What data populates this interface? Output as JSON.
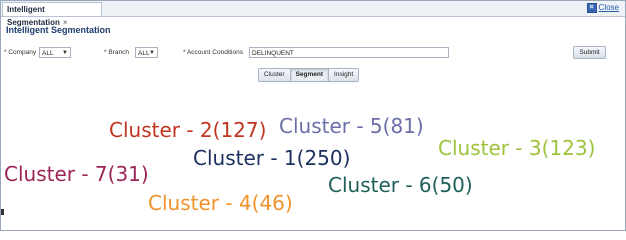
{
  "tab": {
    "label": "Intelligent Segmentation",
    "close_glyph": "×"
  },
  "close_link": {
    "label": "Close",
    "icon": "close-icon"
  },
  "page_title": "Intelligent Segmentation",
  "filters": {
    "company": {
      "label": "* Company",
      "value": "ALL"
    },
    "branch": {
      "label": "* Branch",
      "value": "ALL"
    },
    "account_conditions": {
      "label": "* Account Conditions",
      "value": "DELINQUENT"
    },
    "submit_label": "Submit"
  },
  "view_toggle": {
    "options": [
      "Cluster",
      "Segment",
      "Insight"
    ],
    "selected": "Segment"
  },
  "clusters": [
    {
      "label": "Cluster - 2(127)",
      "color": "#c0351f"
    },
    {
      "label": "Cluster - 5(81)",
      "color": "#6b6fa8"
    },
    {
      "label": "Cluster - 3(123)",
      "color": "#9cc33b"
    },
    {
      "label": "Cluster - 1(250)",
      "color": "#1c2f5e"
    },
    {
      "label": "Cluster - 7(31)",
      "color": "#9b2456"
    },
    {
      "label": "Cluster - 6(50)",
      "color": "#1f5f5a"
    },
    {
      "label": "Cluster - 4(46)",
      "color": "#f0922a"
    }
  ]
}
